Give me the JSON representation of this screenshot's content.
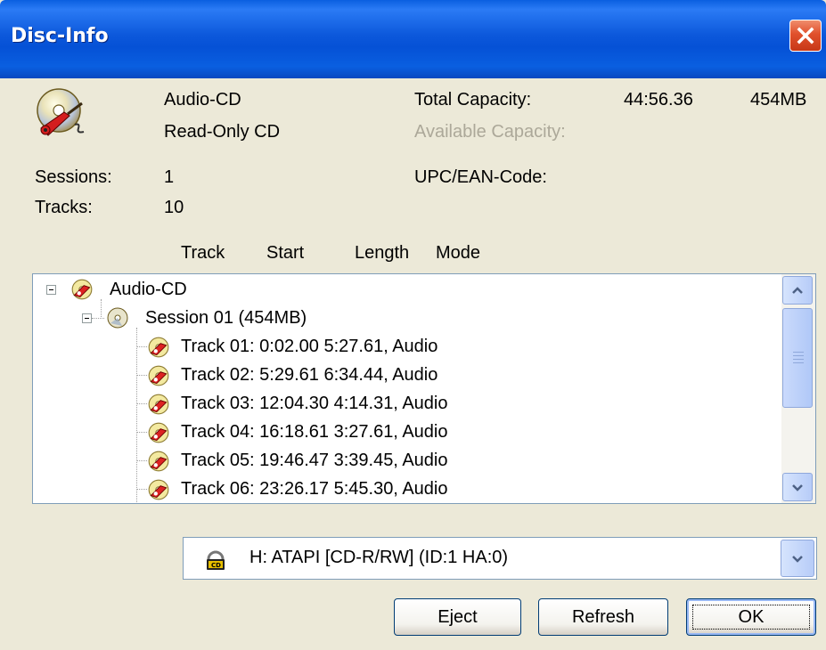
{
  "window": {
    "title": "Disc-Info"
  },
  "disc": {
    "type": "Audio-CD",
    "media": "Read-Only CD",
    "total_capacity_label": "Total Capacity:",
    "total_capacity_time": "44:56.36",
    "total_capacity_size": "454MB",
    "available_capacity_label": "Available Capacity:",
    "upc_label": "UPC/EAN-Code:",
    "sessions_label": "Sessions:",
    "sessions_value": "1",
    "tracks_label": "Tracks:",
    "tracks_value": "10"
  },
  "columns": [
    "Track",
    "Start",
    "Length",
    "Mode"
  ],
  "tree": {
    "root": "Audio-CD",
    "session": "Session 01   (454MB)",
    "tracks": [
      "Track 01: 0:02.00   5:27.61,  Audio",
      "Track 02: 5:29.61   6:34.44,  Audio",
      "Track 03: 12:04.30   4:14.31,  Audio",
      "Track 04: 16:18.61   3:27.61,  Audio",
      "Track 05: 19:46.47   3:39.45,  Audio",
      "Track 06: 23:26.17   5:45.30,  Audio"
    ]
  },
  "drive": {
    "selected": "H:  ATAPI     [CD-R/RW] (ID:1  HA:0)"
  },
  "buttons": {
    "eject": "Eject",
    "refresh": "Refresh",
    "ok": "OK"
  },
  "icons": {
    "disc": "audio-cd-guitar-icon",
    "session": "cd-disc-icon",
    "track": "track-note-icon",
    "drive": "cd-drive-icon",
    "close": "close-icon"
  },
  "colors": {
    "titlebar": "#0A5FE0",
    "close": "#E0502B",
    "face": "#ECE9D8",
    "disabled_text": "#ACA899"
  }
}
